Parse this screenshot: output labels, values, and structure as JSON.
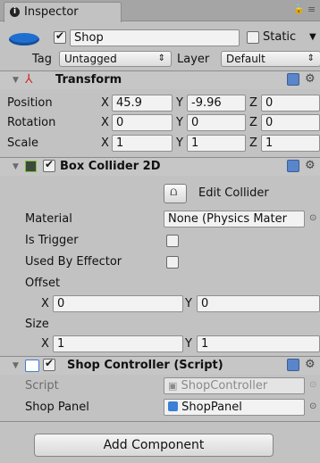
{
  "tab": {
    "label": "Inspector",
    "lock_icon": "lock-icon"
  },
  "header": {
    "object_name": "Shop",
    "static_label": "Static",
    "tag_label": "Tag",
    "tag_value": "Untagged",
    "layer_label": "Layer",
    "layer_value": "Default"
  },
  "transform": {
    "title": "Transform",
    "position_label": "Position",
    "rotation_label": "Rotation",
    "scale_label": "Scale",
    "x_label": "X",
    "y_label": "Y",
    "z_label": "Z",
    "position": {
      "x": "45.9",
      "y": "-9.96",
      "z": "0"
    },
    "rotation": {
      "x": "0",
      "y": "0",
      "z": "0"
    },
    "scale": {
      "x": "1",
      "y": "1",
      "z": "1"
    }
  },
  "box_collider": {
    "title": "Box Collider 2D",
    "edit_collider_label": "Edit Collider",
    "material_label": "Material",
    "material_value": "None (Physics Mater",
    "is_trigger_label": "Is Trigger",
    "used_by_effector_label": "Used By Effector",
    "offset_label": "Offset",
    "size_label": "Size",
    "x_label": "X",
    "y_label": "Y",
    "offset": {
      "x": "0",
      "y": "0"
    },
    "size": {
      "x": "1",
      "y": "1"
    }
  },
  "shop_controller": {
    "title": "Shop Controller (Script)",
    "script_label": "Script",
    "script_value": "ShopController",
    "shop_panel_label": "Shop Panel",
    "shop_panel_value": "ShopPanel"
  },
  "add_component_label": "Add Component",
  "colors": {
    "accent": "#1f6fd1",
    "panel_bg": "#c2c2c2",
    "header_bg": "#c6c6c6",
    "field_bg": "#f2f2f2"
  }
}
